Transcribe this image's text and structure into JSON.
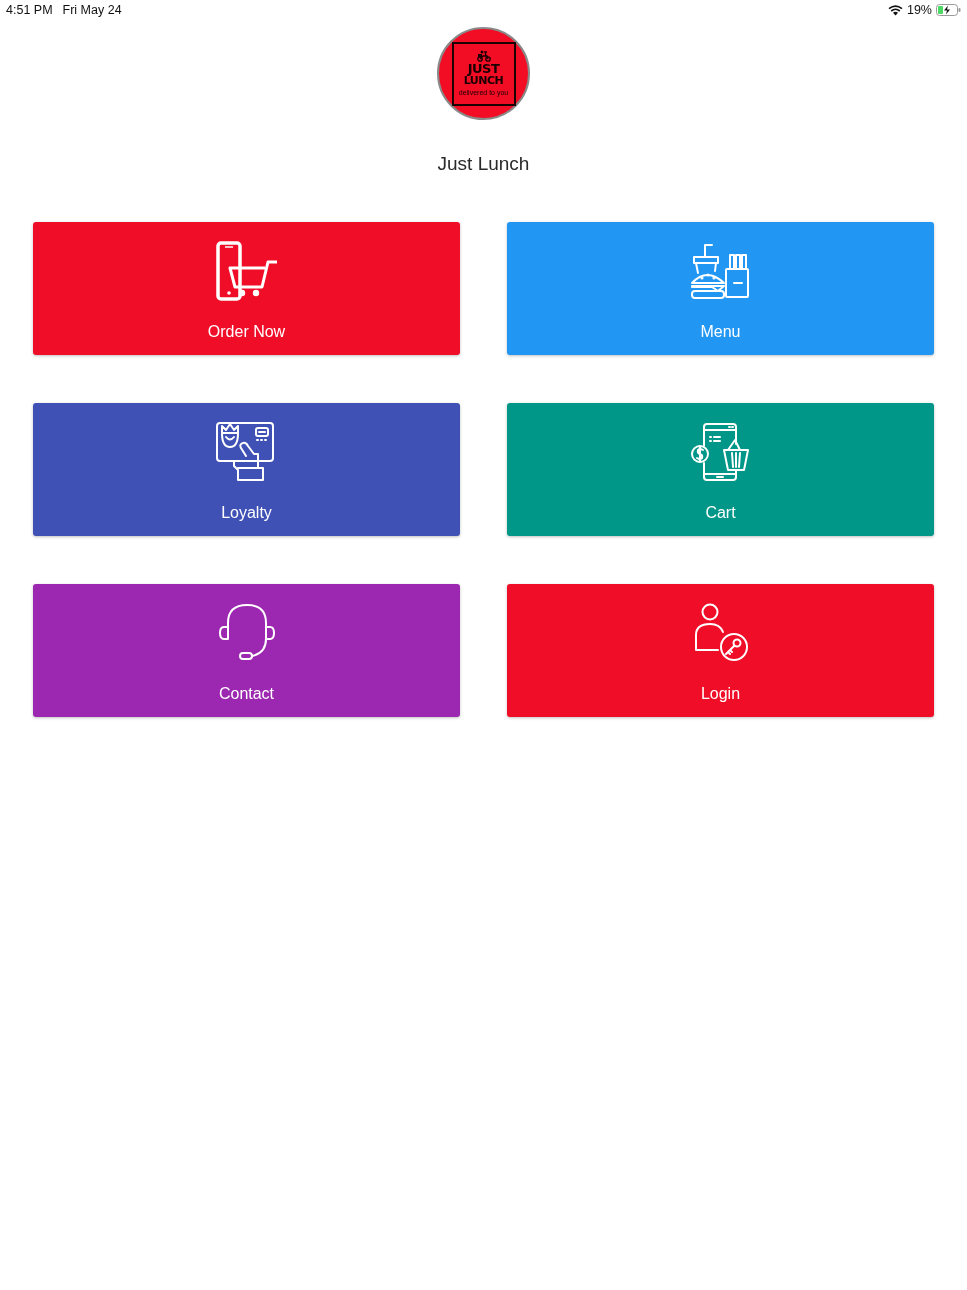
{
  "status_bar": {
    "time": "4:51 PM",
    "date": "Fri May 24",
    "battery": "19%"
  },
  "logo": {
    "line_1": "JUST",
    "line_2": "LUNCH",
    "tagline": "delivered to you"
  },
  "title": "Just Lunch",
  "tiles": [
    {
      "label": "Order Now",
      "color": "#f00d27"
    },
    {
      "label": "Menu",
      "color": "#2196f3"
    },
    {
      "label": "Loyalty",
      "color": "#3f51b5"
    },
    {
      "label": "Cart",
      "color": "#009688"
    },
    {
      "label": "Contact",
      "color": "#9c27b0"
    },
    {
      "label": "Login",
      "color": "#f00d27"
    }
  ]
}
